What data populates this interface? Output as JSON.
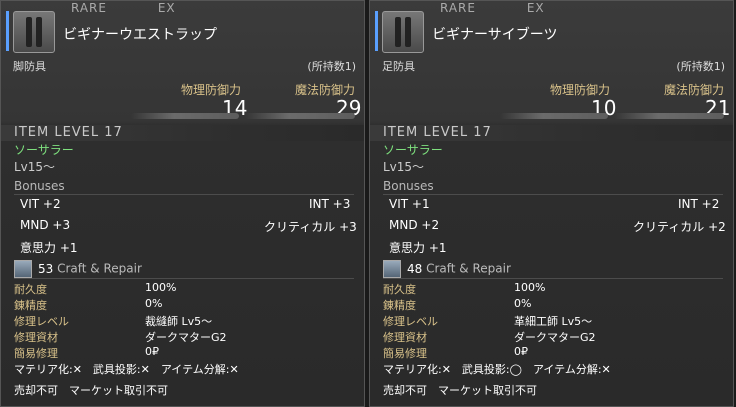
{
  "items": [
    {
      "top_labels": [
        "RARE",
        "EX"
      ],
      "name": "ビギナーウエストラップ",
      "slot": "脚防具",
      "owned": "(所持数1)",
      "phys_label": "物理防御力",
      "mag_label": "魔法防御力",
      "phys_value": "14",
      "mag_value": "29",
      "item_level": "ITEM LEVEL 17",
      "job": "ソーサラー",
      "level": "Lv15～",
      "bonuses_label": "Bonuses",
      "bonuses": [
        "VIT +2",
        "INT +3",
        "MND +3",
        "クリティカル +3",
        "意思力 +1"
      ],
      "craft_num": "53",
      "craft_label": "Craft & Repair",
      "repair_rows": [
        {
          "k": "耐久度",
          "v": "100%"
        },
        {
          "k": "錬精度",
          "v": "0%"
        },
        {
          "k": "修理レベル",
          "v": "裁縫師 Lv5～"
        },
        {
          "k": "修理資材",
          "v": "ダークマターG2"
        },
        {
          "k": "簡易修理",
          "v": "0₽"
        }
      ],
      "materia_line": "マテリア化:✕　武具投影:✕　アイテム分解:✕",
      "sale_line": "売却不可　マーケット取引不可"
    },
    {
      "top_labels": [
        "RARE",
        "EX"
      ],
      "name": "ビギナーサイブーツ",
      "slot": "足防具",
      "owned": "(所持数1)",
      "phys_label": "物理防御力",
      "mag_label": "魔法防御力",
      "phys_value": "10",
      "mag_value": "21",
      "item_level": "ITEM LEVEL 17",
      "job": "ソーサラー",
      "level": "Lv15～",
      "bonuses_label": "Bonuses",
      "bonuses": [
        "VIT +1",
        "INT +2",
        "MND +2",
        "クリティカル +2",
        "意思力 +1"
      ],
      "craft_num": "48",
      "craft_label": "Craft & Repair",
      "repair_rows": [
        {
          "k": "耐久度",
          "v": "100%"
        },
        {
          "k": "錬精度",
          "v": "0%"
        },
        {
          "k": "修理レベル",
          "v": "革細工師 Lv5～"
        },
        {
          "k": "修理資材",
          "v": "ダークマターG2"
        },
        {
          "k": "簡易修理",
          "v": "0₽"
        }
      ],
      "materia_line": "マテリア化:✕　武具投影:◯　アイテム分解:✕",
      "sale_line": "売却不可　マーケット取引不可"
    }
  ],
  "colors": {
    "accent": "#5aa0ff",
    "job": "#7ee07e",
    "key": "#d9c28a"
  }
}
